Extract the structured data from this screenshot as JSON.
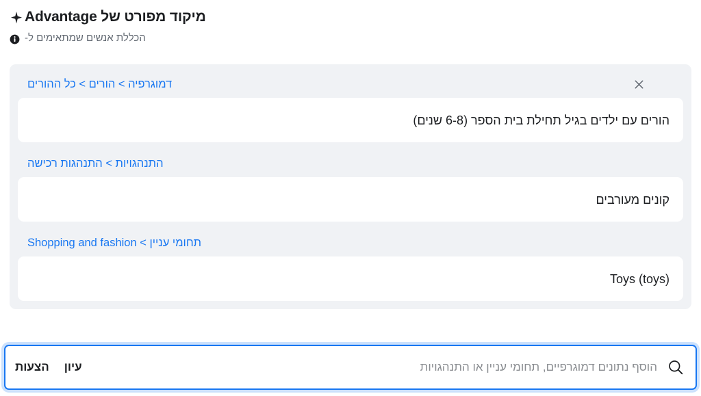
{
  "header": {
    "title": "מיקוד מפורט של Advantage",
    "sparkle_icon": "sparkle-icon",
    "subtitle": "הכללת אנשים שמתאימים ל-",
    "info_icon": "info-icon"
  },
  "card": {
    "close_icon": "close-icon",
    "groups": [
      {
        "breadcrumb": "דמוגרפיה > הורים > כל ההורים",
        "chip": "הורים עם ילדים בגיל תחילת בית הספר (6-8 שנים)",
        "has_close": true
      },
      {
        "breadcrumb": "התנהגויות > התנהגות רכישה",
        "chip": "קונים מעורבים",
        "has_close": false
      },
      {
        "breadcrumb": "תחומי עניין > Shopping and fashion",
        "chip": "Toys (toys)",
        "has_close": false
      }
    ]
  },
  "search": {
    "icon": "search-icon",
    "value": "",
    "placeholder": "הוסף נתונים דמוגרפיים, תחומי עניין או התנהגויות",
    "browse_label": "עיון",
    "suggestions_label": "הצעות"
  },
  "colors": {
    "accent": "#1877f2",
    "card_bg": "#f0f2f5",
    "chip_bg": "#ffffff",
    "text": "#1c1e21",
    "muted": "#606770",
    "placeholder": "#8a8d91"
  }
}
